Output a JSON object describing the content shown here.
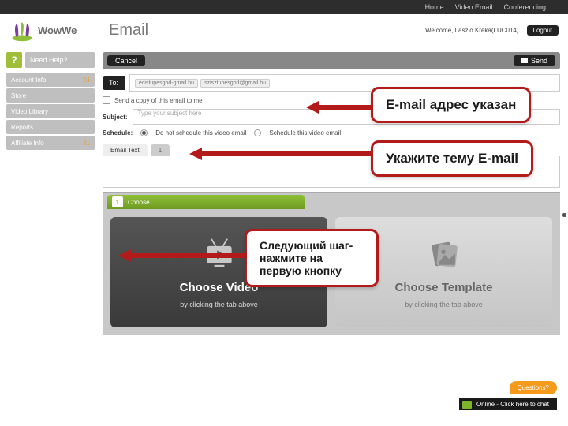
{
  "topnav": {
    "home": "Home",
    "video_email": "Video Email",
    "conferencing": "Conferencing"
  },
  "brand": "WowWe",
  "page_title": "Email",
  "welcome": "Welcome, Laszlo Kreka(LUC014)",
  "logout": "Logout",
  "sidebar": {
    "help_q": "?",
    "help_label": "Need Help?",
    "items": [
      {
        "label": "Account Info",
        "badge": "24"
      },
      {
        "label": "Store",
        "badge": ""
      },
      {
        "label": "Video Library",
        "badge": ""
      },
      {
        "label": "Reports",
        "badge": ""
      },
      {
        "label": "Affiliate Info",
        "badge": "31"
      }
    ]
  },
  "actionbar": {
    "cancel": "Cancel",
    "send": "Send"
  },
  "compose": {
    "to_label": "To:",
    "to_chips": [
      "ecistupesgod-gmail.hu",
      "szisztupesgod@gmail.hu"
    ],
    "copy_checkbox": "Send a copy of this email to me",
    "subject_label": "Subject:",
    "subject_placeholder": "Type your subject here",
    "schedule_label": "Schedule:",
    "schedule_no": "Do not schedule this video email",
    "schedule_yes": "Schedule this video email",
    "tab_email_text": "Email Text",
    "tab_icon": "1"
  },
  "steps": {
    "num": "1",
    "title": "Choose",
    "card1": {
      "title": "Choose Video",
      "sub": "by clicking the tab above"
    },
    "card2": {
      "title": "Choose Template",
      "sub": "by clicking the tab above"
    }
  },
  "callouts": {
    "c1": "E-mail адрес указан",
    "c2": "Укажите тему E-mail",
    "c3": "Следующий шаг- нажмите на первую кнопку"
  },
  "support": {
    "questions": "Questions?",
    "chat": "Online - Click here to chat"
  }
}
